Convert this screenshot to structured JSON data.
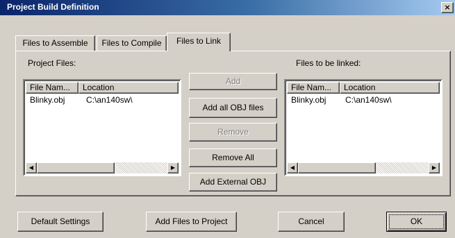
{
  "window": {
    "title": "Project Build Definition",
    "close_glyph": "×"
  },
  "tabs": [
    {
      "label": "Files to Assemble",
      "active": false
    },
    {
      "label": "Files to Compile",
      "active": false
    },
    {
      "label": "Files to Link",
      "active": true
    }
  ],
  "project_files": {
    "label": "Project Files:",
    "columns": [
      "File Nam...",
      "Location"
    ],
    "rows": [
      [
        "Blinky.obj",
        "C:\\an140sw\\"
      ]
    ]
  },
  "linked_files": {
    "label": "Files to be linked:",
    "columns": [
      "File Nam...",
      "Location"
    ],
    "rows": [
      [
        "Blinky.obj",
        "C:\\an140sw\\"
      ]
    ]
  },
  "middle_buttons": {
    "add": "Add",
    "add_all_obj": "Add all OBJ files",
    "remove": "Remove",
    "remove_all": "Remove All",
    "add_external_obj": "Add External OBJ"
  },
  "bottom_buttons": {
    "default_settings": "Default Settings",
    "add_files_to_project": "Add Files to Project",
    "cancel": "Cancel",
    "ok": "OK"
  },
  "scroll": {
    "left_glyph": "◀",
    "right_glyph": "▶"
  },
  "colors": {
    "face": "#d4d0c8",
    "title_start": "#0a246a",
    "title_end": "#a6caf0"
  }
}
